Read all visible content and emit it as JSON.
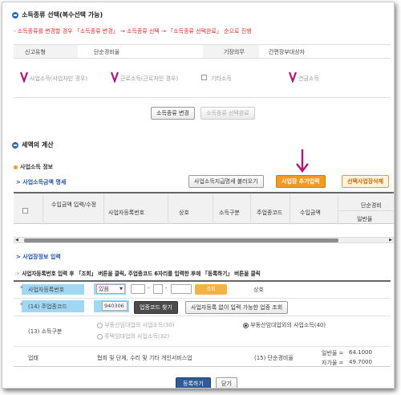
{
  "income_type_section": {
    "title": "소득종류 선택(복수선택 가능)",
    "notice": "- 소득종류를 변경할 경우 「소득종류 변경」 → 소득종류 선택 → 「소득종류 선택완료」 순으로 진행",
    "report_type_label": "신고유형",
    "report_type_value": "단순경비율",
    "bookkeeping_label": "기장의무",
    "bookkeeping_value": "간편장부대상자",
    "options": [
      {
        "label": "사업소득(사업자인 경우)",
        "checked": true
      },
      {
        "label": "근로소득(근로자인 경우)",
        "checked": true
      },
      {
        "label": "기타소득",
        "checked": false
      },
      {
        "label": "연금소득",
        "checked": true
      }
    ],
    "change_button": "소득종류 변경",
    "complete_button": "소득종류 선택완료"
  },
  "tax_calc_section": {
    "title": "세액의 계산",
    "business_income_info": "사업소득 정보",
    "business_income_link": "> 사업소득금액 명세",
    "load_button": "사업소득지급명세 불러오기",
    "add_button": "사업장 추가입력",
    "delete_button": "선택사업장삭제",
    "table_headers": [
      "수입금액 입력/수정",
      "사업자등록번호",
      "상호",
      "소득구분",
      "주업종코드",
      "수입금액",
      "단순경비",
      "일반율"
    ]
  },
  "business_input_section": {
    "link": "> 사업장정보 입력",
    "instruction": "☞ 사업자등록번호 입력 후 「조회」 버튼을 클릭, 주업종코드 6자리를 입력한 후에 「등록하기」 버튼을 클릭",
    "reg_no_label": "사업자등록번호",
    "reg_no_select": "있음",
    "lookup_button": "조회",
    "trade_name_label": "상호",
    "industry_code_label": "(14) 주업종코드",
    "industry_code_value": "940306",
    "find_code_button": "업종코드 찾기",
    "no_reg_button": "사업자등록 없이 입력 가능한 업종 조회",
    "income_class_label": "(13) 소득구분",
    "radio_options": [
      {
        "label": "부동산임대업의 사업소득(30)",
        "selected": false
      },
      {
        "label": "부동산임대업외의 사업소득(40)",
        "selected": true
      },
      {
        "label": "주택임대업의 사업소득(32)",
        "selected": false
      }
    ],
    "business_type_label": "업태",
    "business_type_value": "협회 및 단체, 수리 및 기타 개인서비스업",
    "simple_rate_label": "(15) 단순경비율",
    "general_rate_label": "일반율 =",
    "general_rate_value": "64.1000",
    "own_rate_label": "자가율 =",
    "own_rate_value": "49.7000",
    "register_button": "등록하기",
    "close_button": "닫기"
  }
}
